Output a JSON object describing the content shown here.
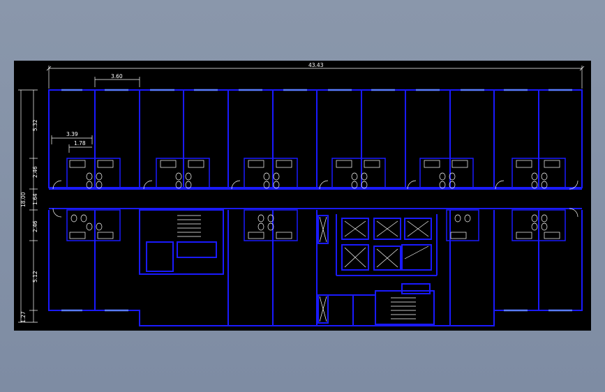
{
  "drawing": {
    "background": "#000000",
    "wall_color": "#1a1aff",
    "dim_color": "#ffffff",
    "fixture_color": "#ffffff",
    "window_color": "#5a7cff",
    "dimensions": {
      "overall_width": "43.43",
      "bay_width": "3.60",
      "bath_width": "3.39",
      "bath_inner": "1.78",
      "overall_depth": "18.00",
      "room_depth_top": "5.32",
      "bath_depth_top": "2.46",
      "corridor": "1.64",
      "bath_depth_bottom": "2.46",
      "room_depth_bottom": "5.12",
      "bottom_offset": "1.27"
    }
  }
}
